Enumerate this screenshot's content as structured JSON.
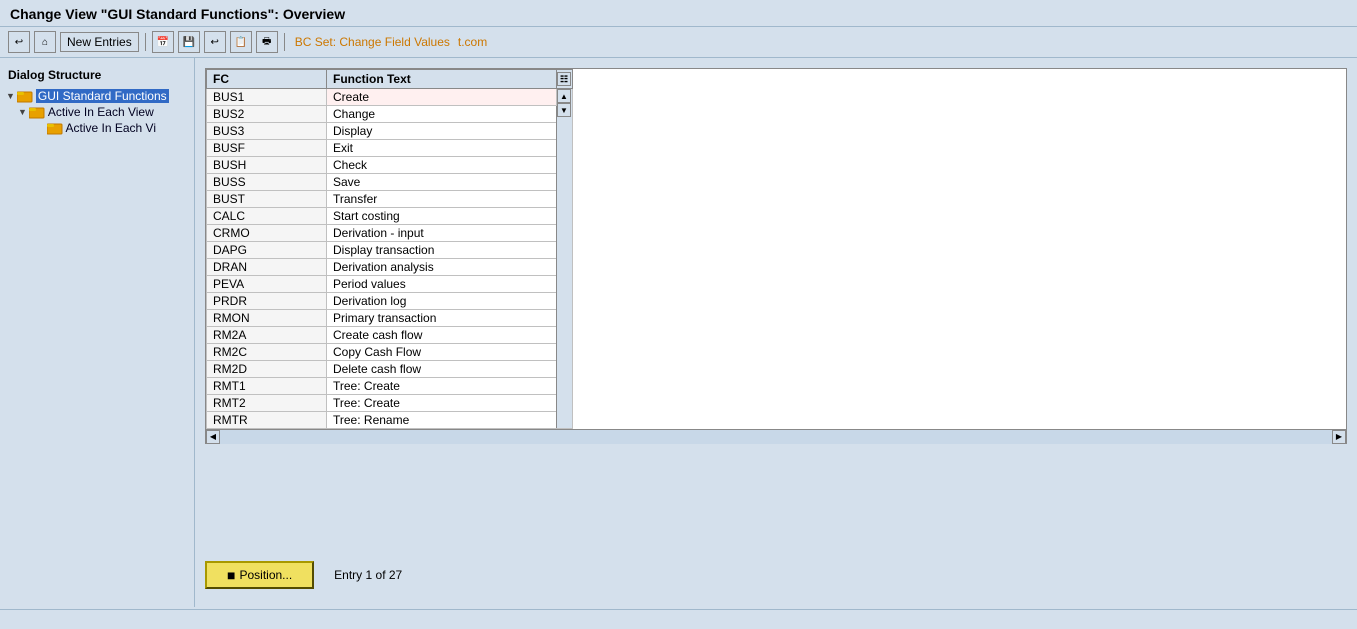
{
  "title": "Change View \"GUI Standard Functions\": Overview",
  "toolbar": {
    "new_entries_label": "New Entries",
    "bc_set_label": "BC Set: Change Field Values",
    "watermark_text": "t.com"
  },
  "sidebar": {
    "title": "Dialog Structure",
    "items": [
      {
        "id": "gui-standard-functions",
        "label": "GUI Standard Functions",
        "level": 0,
        "selected": true,
        "icon": "folder",
        "arrow": "▼"
      },
      {
        "id": "active-in-each-view",
        "label": "Active In Each View",
        "level": 1,
        "selected": false,
        "icon": "folder",
        "arrow": "▼"
      },
      {
        "id": "active-in-each-view-2",
        "label": "Active In Each Vi",
        "level": 2,
        "selected": false,
        "icon": "folder",
        "arrow": ""
      }
    ]
  },
  "table": {
    "columns": [
      {
        "id": "fc",
        "label": "FC"
      },
      {
        "id": "text",
        "label": "Function Text"
      }
    ],
    "rows": [
      {
        "fc": "BUS1",
        "text": "Create"
      },
      {
        "fc": "BUS2",
        "text": "Change"
      },
      {
        "fc": "BUS3",
        "text": "Display"
      },
      {
        "fc": "BUSF",
        "text": "Exit"
      },
      {
        "fc": "BUSH",
        "text": "Check"
      },
      {
        "fc": "BUSS",
        "text": "Save"
      },
      {
        "fc": "BUST",
        "text": "Transfer"
      },
      {
        "fc": "CALC",
        "text": "Start costing"
      },
      {
        "fc": "CRMO",
        "text": "Derivation - input"
      },
      {
        "fc": "DAPG",
        "text": "Display transaction"
      },
      {
        "fc": "DRAN",
        "text": "Derivation analysis"
      },
      {
        "fc": "PEVA",
        "text": "Period values"
      },
      {
        "fc": "PRDR",
        "text": "Derivation log"
      },
      {
        "fc": "RMON",
        "text": "Primary transaction"
      },
      {
        "fc": "RM2A",
        "text": "Create cash flow"
      },
      {
        "fc": "RM2C",
        "text": "Copy Cash Flow"
      },
      {
        "fc": "RM2D",
        "text": "Delete cash flow"
      },
      {
        "fc": "RMT1",
        "text": "Tree: Create"
      },
      {
        "fc": "RMT2",
        "text": "Tree: Create"
      },
      {
        "fc": "RMTR",
        "text": "Tree: Rename"
      }
    ]
  },
  "bottom": {
    "position_label": "Position...",
    "entry_info": "Entry 1 of 27"
  },
  "status_bar": {
    "text": ""
  }
}
